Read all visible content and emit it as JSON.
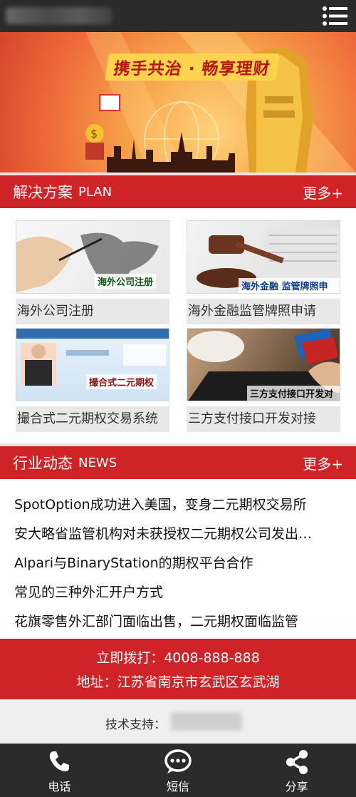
{
  "header": {
    "menu_icon": "menu-list-icon"
  },
  "banner": {
    "title": "携手共治 · 畅享理财"
  },
  "solutions": {
    "title": "解决方案",
    "subtitle": "PLAN",
    "more": "更多+",
    "items": [
      {
        "label": "海外公司注册",
        "image_tag": "海外公司注册"
      },
      {
        "label": "海外金融监管牌照申请",
        "image_tag": "海外金融 监管牌照申请"
      },
      {
        "label": "撮合式二元期权交易系统",
        "image_tag": "撮合式二元期权"
      },
      {
        "label": "三方支付接口开发对接",
        "image_tag": "三方支付接口开发对接"
      }
    ]
  },
  "news": {
    "title": "行业动态",
    "subtitle": "NEWS",
    "more": "更多+",
    "items": [
      "SpotOption成功进入美国，变身二元期权交易所",
      "安大略省监管机构对未获授权二元期权公司发出警告",
      "Alpari与BinaryStation的期权平台合作",
      "常见的三种外汇开户方式",
      "花旗零售外汇部门面临出售，二元期权面临监管"
    ]
  },
  "contact": {
    "phone": "立即拨打：4008-888-888",
    "address": "地址：江苏省南京市玄武区玄武湖"
  },
  "support": {
    "label": "技术支持："
  },
  "bottom_nav": [
    {
      "label": "电话",
      "icon": "phone-icon"
    },
    {
      "label": "短信",
      "icon": "sms-chat-icon"
    },
    {
      "label": "分享",
      "icon": "share-icon"
    }
  ],
  "colors": {
    "brand_red": "#cf2328",
    "dark_bar": "#2b2b2b"
  }
}
